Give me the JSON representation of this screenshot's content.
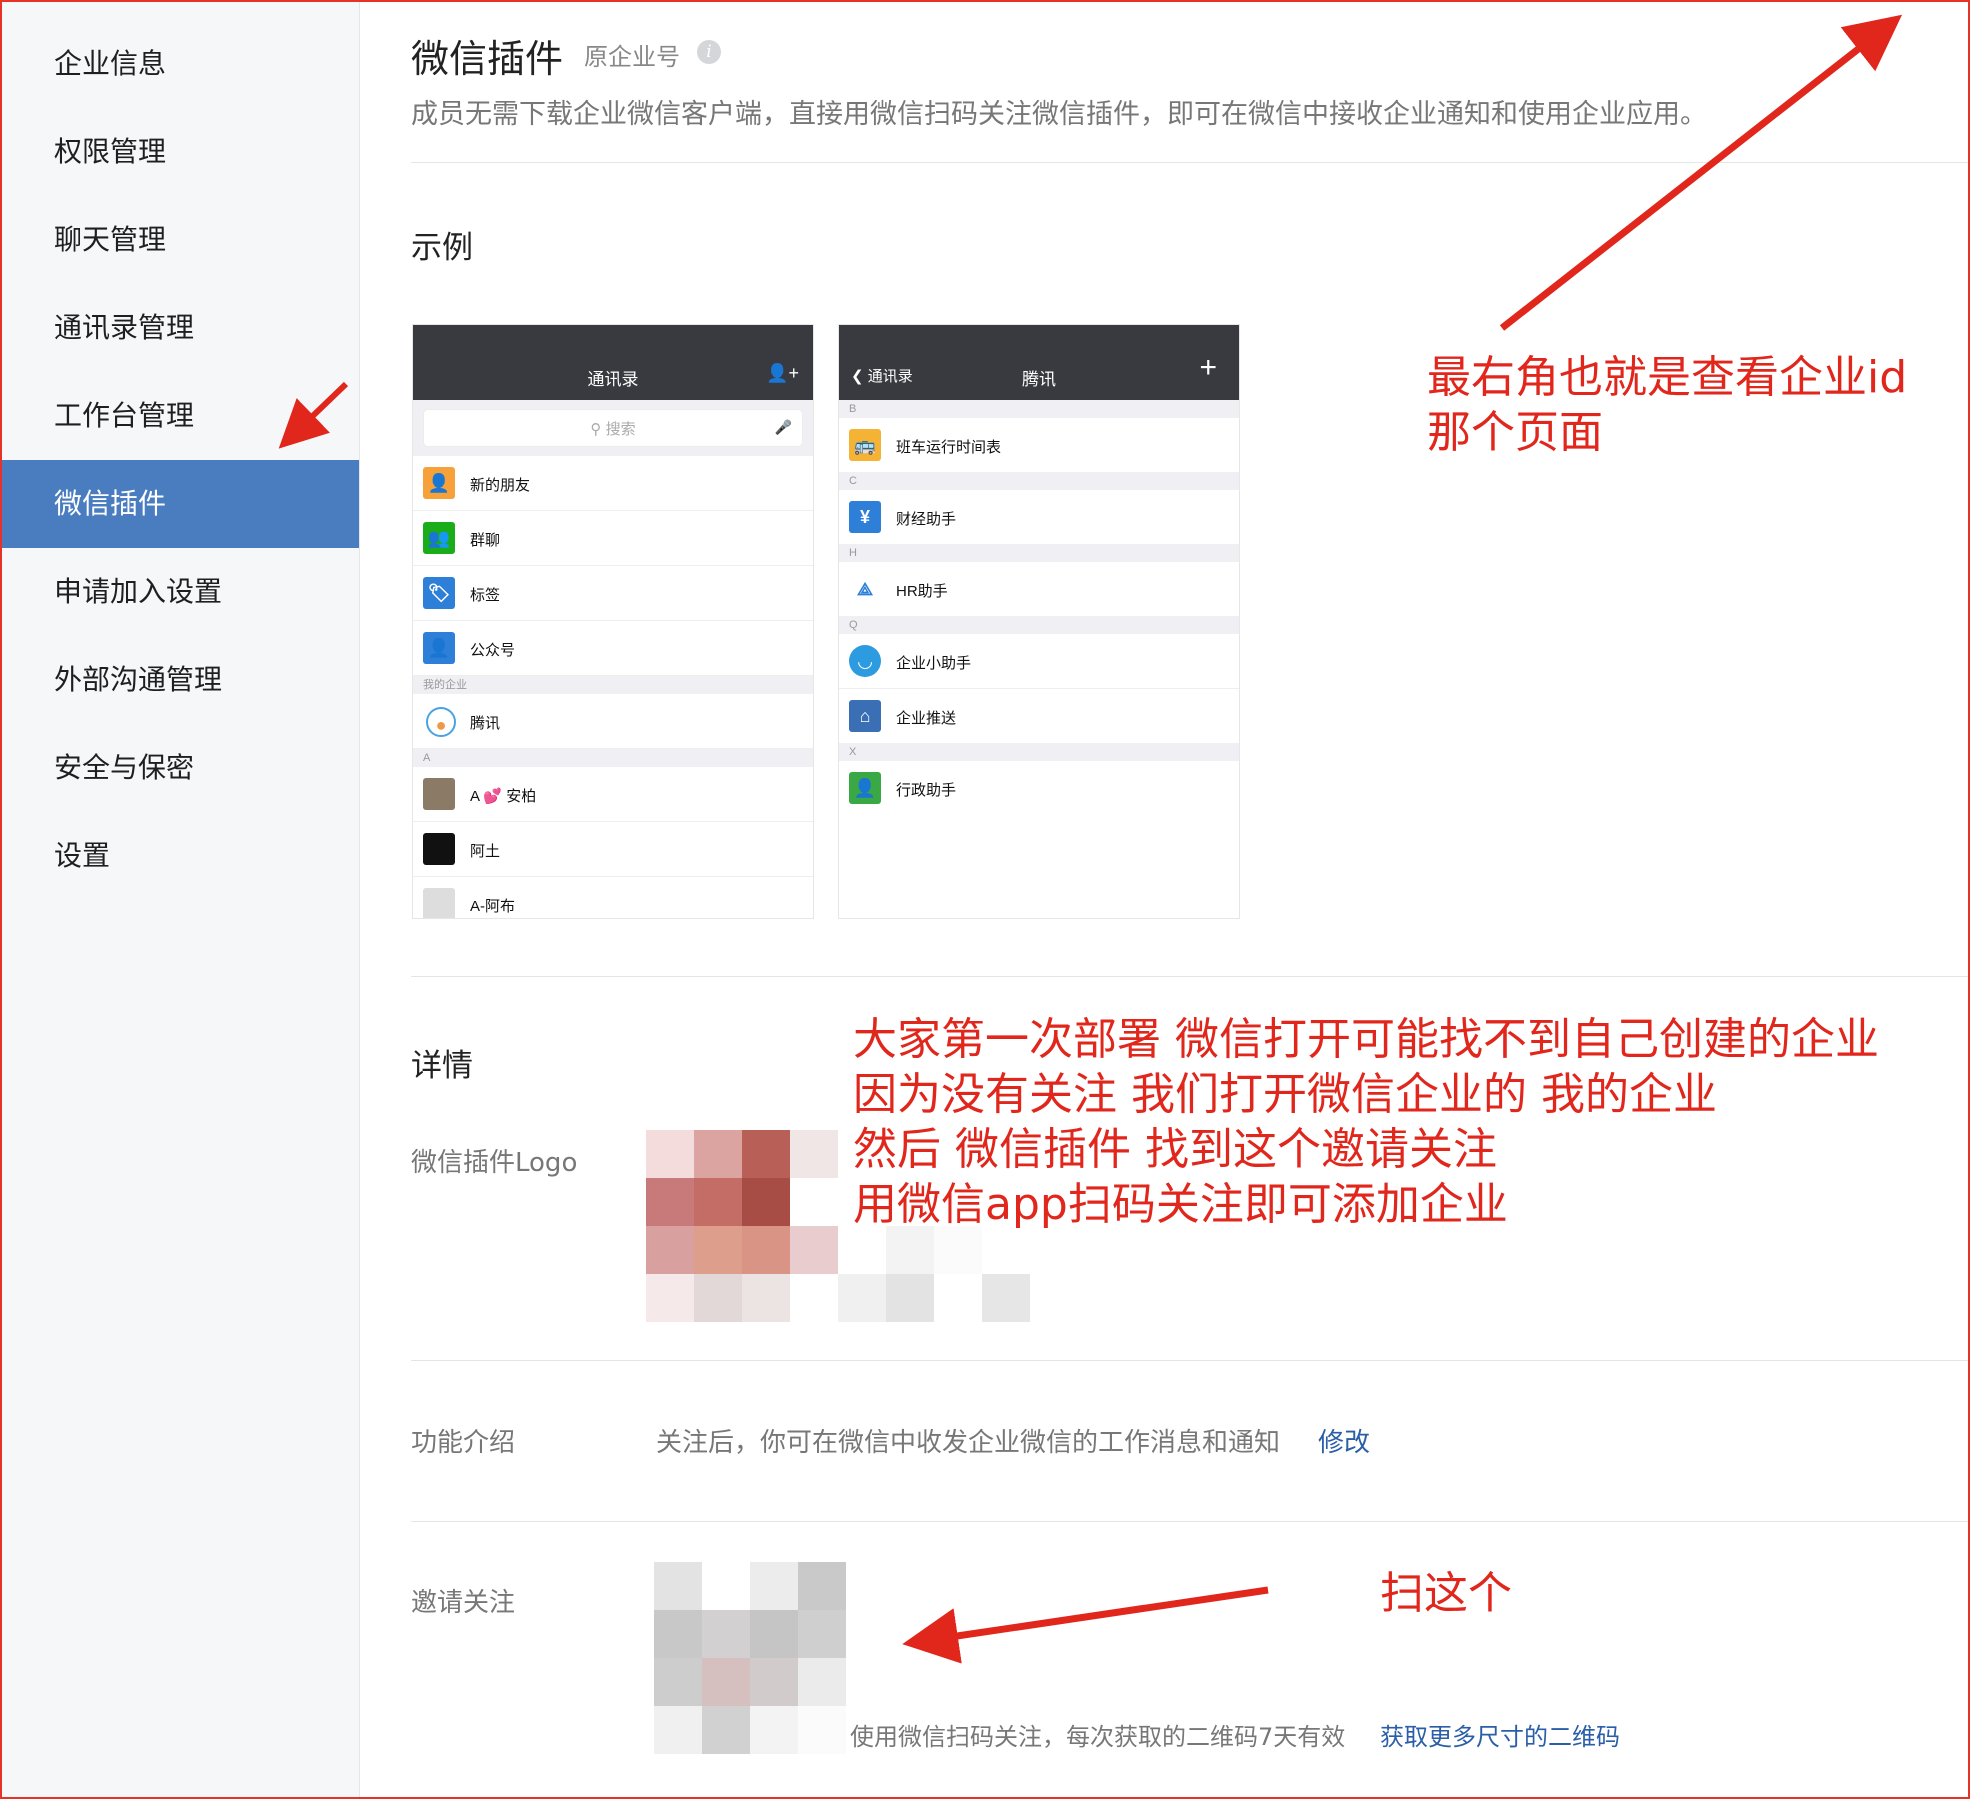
{
  "sidebar": {
    "items": [
      {
        "label": "企业信息"
      },
      {
        "label": "权限管理"
      },
      {
        "label": "聊天管理"
      },
      {
        "label": "通讯录管理"
      },
      {
        "label": "工作台管理"
      },
      {
        "label": "微信插件",
        "active": true
      },
      {
        "label": "申请加入设置"
      },
      {
        "label": "外部沟通管理"
      },
      {
        "label": "安全与保密"
      },
      {
        "label": "设置"
      }
    ]
  },
  "header": {
    "title": "微信插件",
    "tag": "原企业号",
    "info_icon": "i",
    "description": "成员无需下载企业微信客户端，直接用微信扫码关注微信插件，即可在微信中接收企业通知和使用企业应用。"
  },
  "example": {
    "heading": "示例",
    "phone_left": {
      "title": "通讯录",
      "add_friend_icon": "👤+",
      "search_placeholder": "搜索",
      "items": [
        "新的朋友",
        "群聊",
        "标签",
        "公众号"
      ],
      "group_mycorp": "我的企业",
      "corp_item": "腾讯",
      "group_a": "A",
      "contacts": [
        "A 💕 安柏",
        "阿土",
        "A-阿布"
      ]
    },
    "phone_right": {
      "back": "通讯录",
      "title": "腾讯",
      "plus": "+",
      "groups": [
        {
          "letter": "B",
          "items": [
            "班车运行时间表"
          ]
        },
        {
          "letter": "C",
          "items": [
            "财经助手"
          ]
        },
        {
          "letter": "H",
          "items": [
            "HR助手"
          ]
        },
        {
          "letter": "Q",
          "items": [
            "企业小助手",
            "企业推送"
          ]
        },
        {
          "letter": "X",
          "items": [
            "行政助手"
          ]
        }
      ]
    }
  },
  "details": {
    "heading": "详情",
    "logo_label": "微信插件Logo",
    "intro_label": "功能介绍",
    "intro_text": "关注后，你可在微信中收发企业微信的工作消息和通知",
    "intro_edit": "修改",
    "invite_label": "邀请关注",
    "invite_text": "使用微信扫码关注，每次获取的二维码7天有效",
    "invite_link": "获取更多尺寸的二维码"
  },
  "annotations": {
    "top_right": [
      "最右角也就是查看企业id",
      "那个页面"
    ],
    "middle": [
      "大家第一次部署 微信打开可能找不到自己创建的企业",
      "因为没有关注 我们打开微信企业的 我的企业",
      "然后 微信插件 找到这个邀请关注",
      "用微信app扫码关注即可添加企业"
    ],
    "bottom": "扫这个"
  },
  "colors": {
    "accent": "#4a7cc0",
    "annotation": "#e1261c",
    "link": "#2a5ea7"
  }
}
